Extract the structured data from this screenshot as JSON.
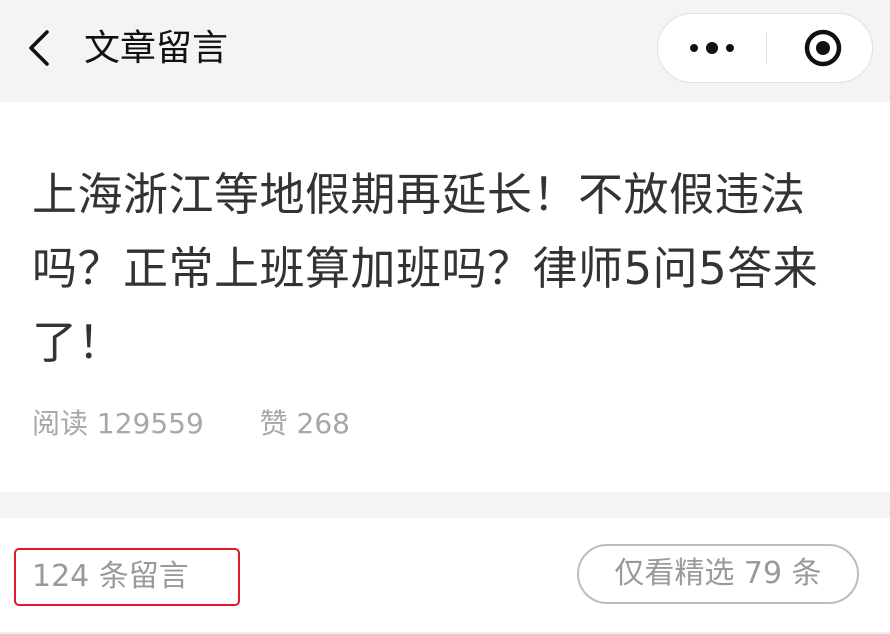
{
  "nav": {
    "title": "文章留言",
    "back_icon": "chevron-left-icon",
    "more_icon": "more-dots-icon",
    "close_icon": "target-circle-icon"
  },
  "article": {
    "title": "上海浙江等地假期再延长！不放假违法吗？正常上班算加班吗？律师5问5答来了！",
    "reads_label": "阅读",
    "reads_value": "129559",
    "likes_label": "赞",
    "likes_value": "268"
  },
  "comments": {
    "count_text": "124 条留言",
    "featured_filter_text": "仅看精选 79 条"
  },
  "colors": {
    "nav_background": "#f4f4f4",
    "highlight_border": "#e0192a",
    "muted_text": "#a7a7a7"
  }
}
